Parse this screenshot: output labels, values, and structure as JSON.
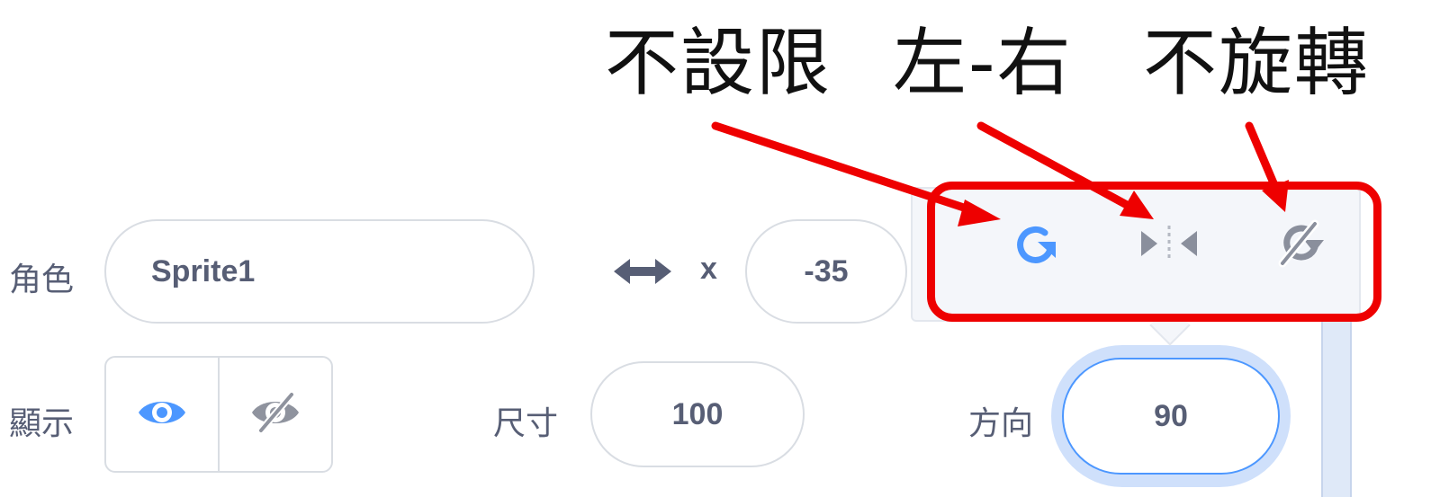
{
  "annotations": {
    "all_around": "不設限",
    "left_right": "左-右",
    "dont_rotate": "不旋轉"
  },
  "sprite_panel": {
    "sprite_label": "角色",
    "sprite_name": "Sprite1",
    "x_label": "x",
    "x_value": "-35",
    "show_label": "顯示",
    "size_label": "尺寸",
    "size_value": "100",
    "direction_label": "方向",
    "direction_value": "90"
  },
  "rotation_styles": [
    {
      "name": "all-around",
      "icon": "rotate-all-around-icon"
    },
    {
      "name": "left-right",
      "icon": "flip-left-right-icon"
    },
    {
      "name": "dont-rotate",
      "icon": "dont-rotate-icon"
    }
  ],
  "colors": {
    "accent_blue": "#4c97ff",
    "annotation_red": "#ee0000",
    "text_gray": "#575e75",
    "icon_gray": "#7a7f8e"
  }
}
